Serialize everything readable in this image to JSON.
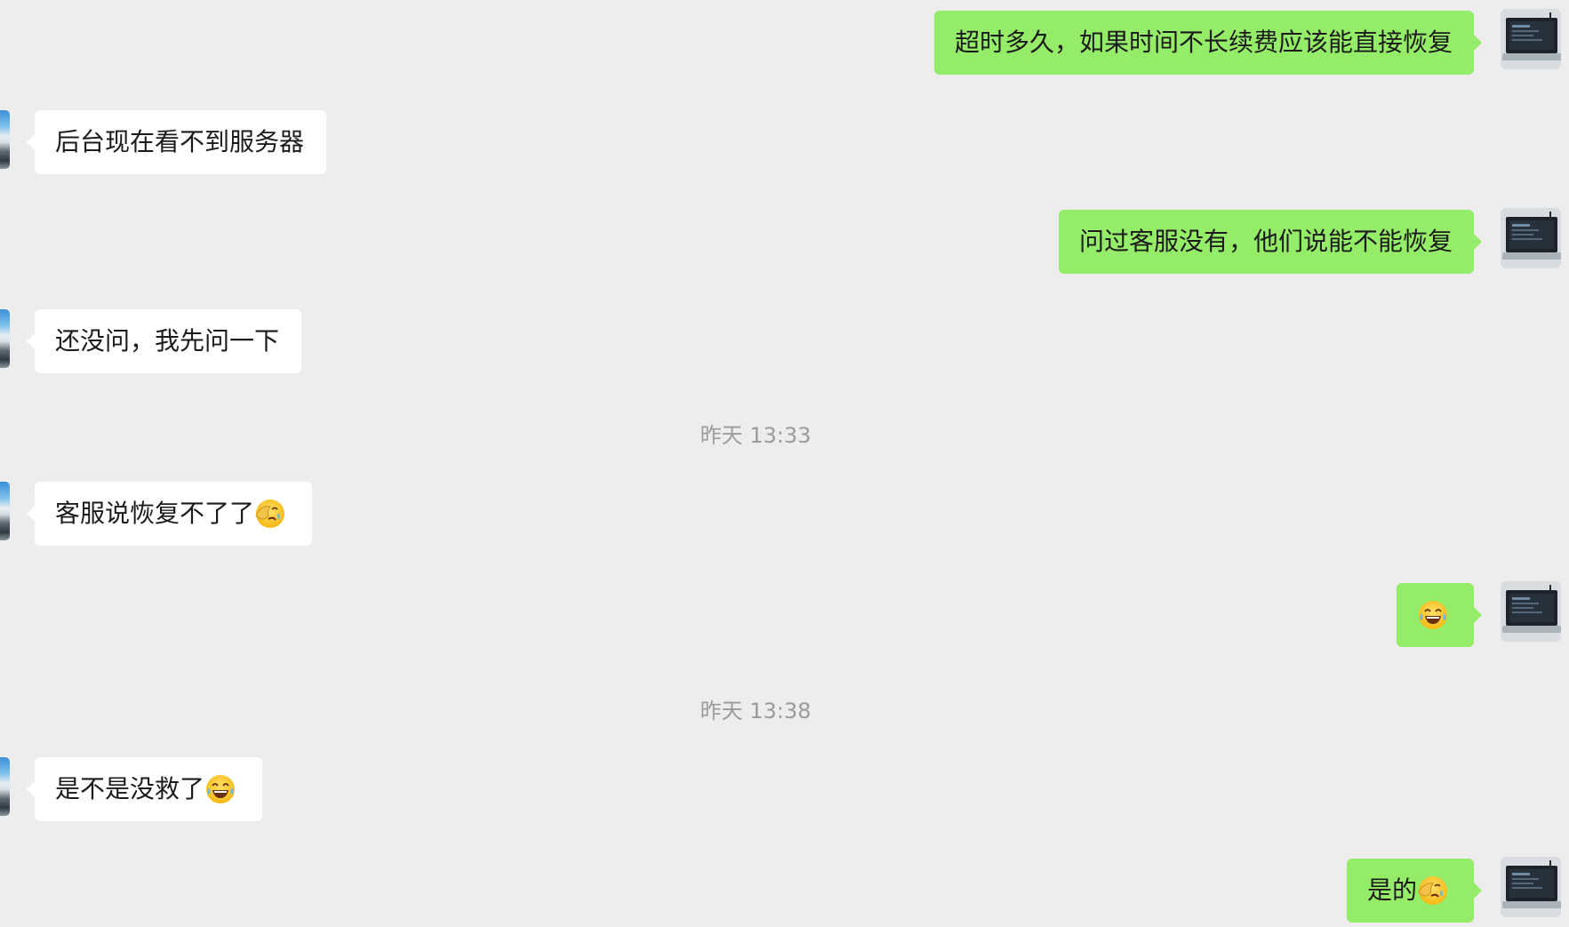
{
  "messages": [
    {
      "side": "out",
      "text": "超时多久，如果时间不长续费应该能直接恢复"
    },
    {
      "side": "in",
      "text": "后台现在看不到服务器"
    },
    {
      "side": "out",
      "text": "问过客服没有，他们说能不能恢复"
    },
    {
      "side": "in",
      "text": "还没问，我先问一下"
    },
    {
      "type": "time",
      "text": "昨天 13:33"
    },
    {
      "side": "in",
      "text": "客服说恢复不了了",
      "emoji": "facepalm-emoji"
    },
    {
      "side": "out",
      "text": "",
      "emoji": "tears-of-joy-emoji"
    },
    {
      "type": "time",
      "text": "昨天 13:38"
    },
    {
      "side": "in",
      "text": "是不是没救了",
      "emoji": "tears-of-joy-emoji"
    },
    {
      "side": "out",
      "text": "是的",
      "emoji": "facepalm-emoji"
    }
  ],
  "colors": {
    "background": "#ededed",
    "incoming_bubble": "#ffffff",
    "outgoing_bubble": "#95ec69",
    "timestamp": "#9b9b9b"
  }
}
